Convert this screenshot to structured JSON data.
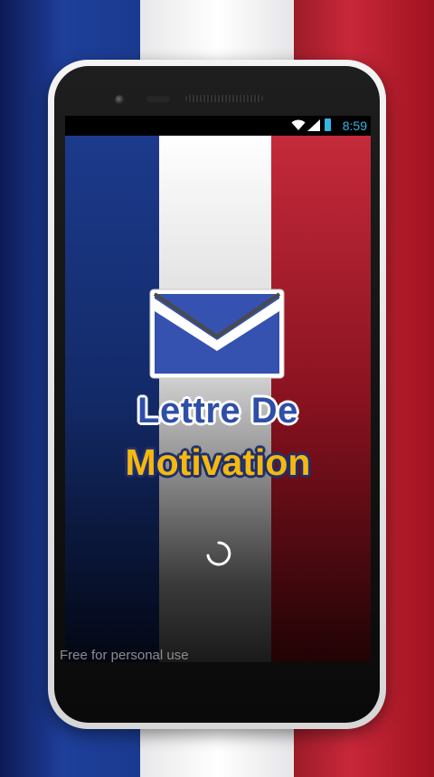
{
  "status_bar": {
    "time": "8:59",
    "icons": [
      "wifi-icon",
      "signal-icon",
      "battery-icon"
    ],
    "accent_color": "#33b5e5"
  },
  "splash": {
    "title_line1": "Lettre De",
    "title_line2": "Motivation",
    "logo_icon": "envelope-icon",
    "loading_icon": "spinner-icon",
    "footer": "Free for personal use"
  },
  "colors": {
    "flag_blue": "#1e3f9a",
    "flag_white": "#ffffff",
    "flag_red": "#c8283a",
    "title_blue": "#2e4ea8",
    "title_gold": "#f5b80f"
  }
}
